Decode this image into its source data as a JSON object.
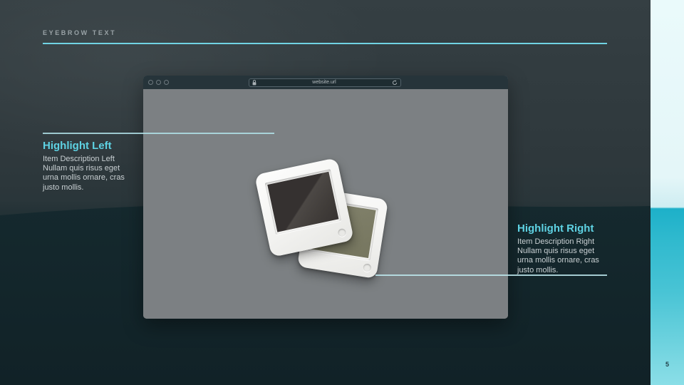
{
  "eyebrow": {
    "label": "EYEBROW TEXT"
  },
  "browser": {
    "url": "website.url",
    "traffic_lights": [
      "close",
      "minimize",
      "zoom"
    ]
  },
  "highlights": {
    "left": {
      "title": "Highlight Left",
      "description": "Item Description Left\nNullam quis risus eget\nurna mollis ornare, cras\njusto mollis."
    },
    "right": {
      "title": "Highlight Right",
      "description": "Item Description Right\nNullam quis risus eget\nurna mollis ornare, cras\njusto mollis."
    }
  },
  "page": {
    "number": "5"
  },
  "icons": {
    "center_illustration": "photo-slides",
    "url_left": "lock-icon",
    "url_right": "refresh-icon"
  },
  "colors": {
    "accent_cyan": "#5ed2e3",
    "rule_cyan": "#70d3e3",
    "band_light": "#eafafb",
    "band_cyan": "#1db0c9",
    "background_top": "#353f43",
    "background_bottom": "#122428",
    "window_bar": "#26343a",
    "window_content": "#7c8083"
  }
}
